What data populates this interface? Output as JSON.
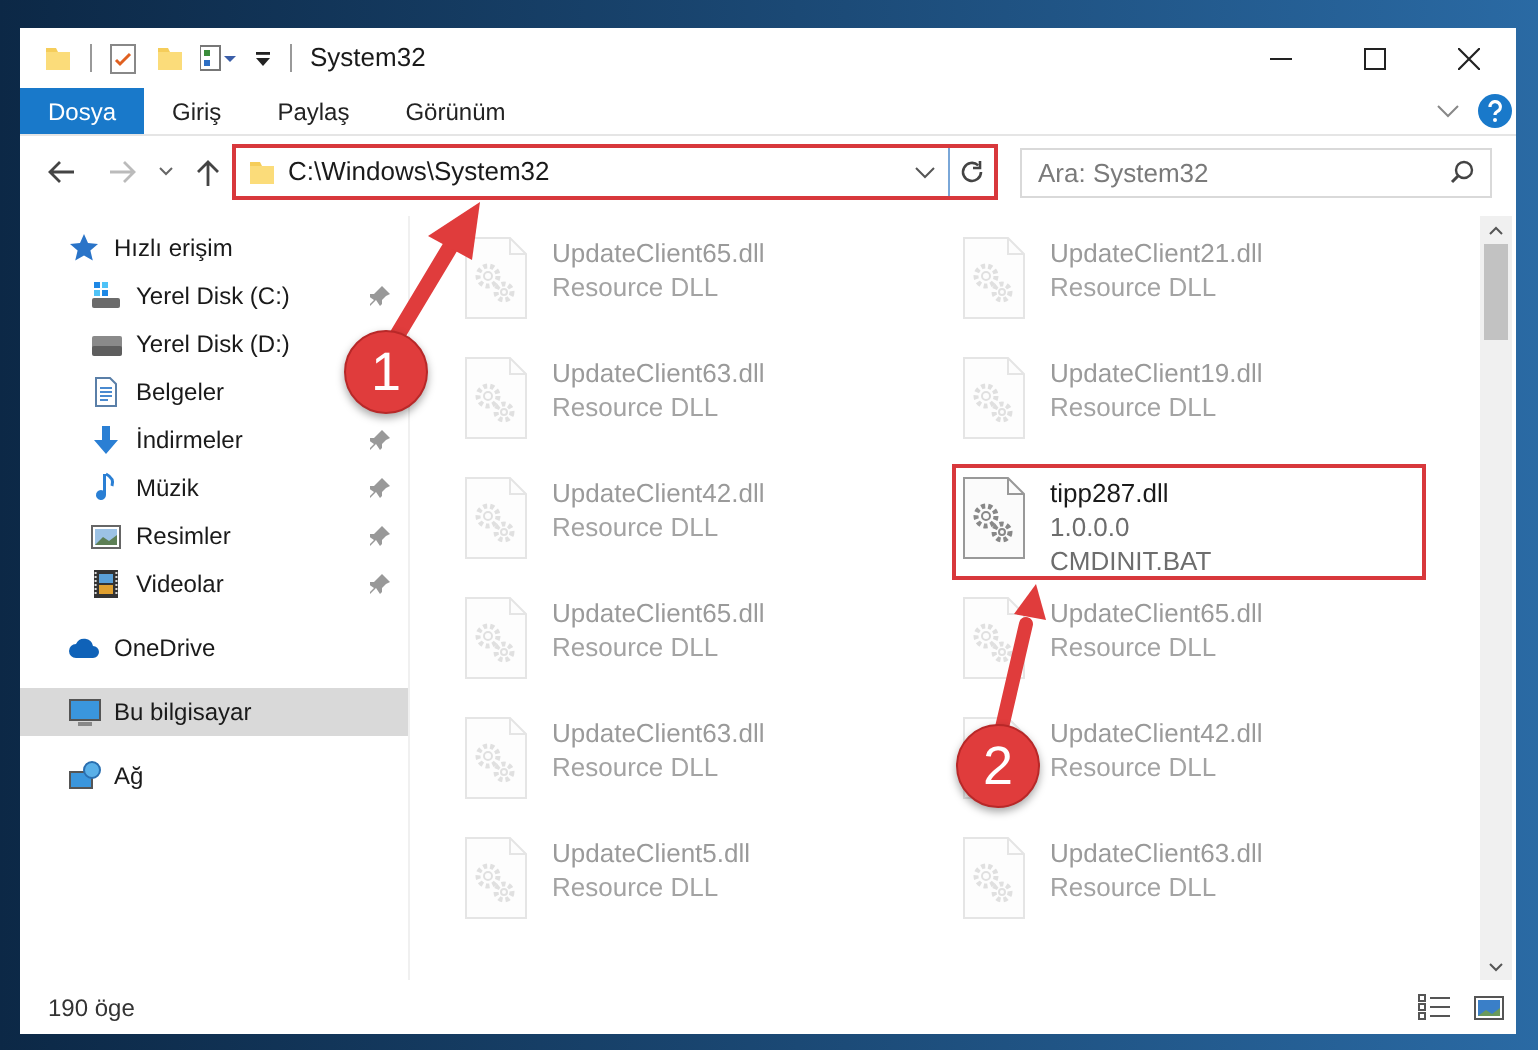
{
  "window": {
    "title": "System32"
  },
  "ribbon_tabs": [
    {
      "label": "Dosya",
      "selected": true
    },
    {
      "label": "Giriş",
      "selected": false
    },
    {
      "label": "Paylaş",
      "selected": false
    },
    {
      "label": "Görünüm",
      "selected": false
    }
  ],
  "address": {
    "path": "C:\\Windows\\System32"
  },
  "search": {
    "placeholder": "Ara: System32"
  },
  "sidebar": {
    "items": [
      {
        "label": "Hızlı erişim",
        "kind": "star",
        "selected": false,
        "children": [
          {
            "label": "Yerel Disk (C:)",
            "kind": "system-drive",
            "pinned": true,
            "selected": false
          },
          {
            "label": "Yerel Disk (D:)",
            "kind": "drive",
            "selected": false
          },
          {
            "label": "Belgeler",
            "kind": "document",
            "selected": false
          },
          {
            "label": "İndirmeler",
            "kind": "download",
            "pinned": true,
            "selected": false
          },
          {
            "label": "Müzik",
            "kind": "music",
            "pinned": true,
            "selected": false
          },
          {
            "label": "Resimler",
            "kind": "image",
            "pinned": true,
            "selected": false
          },
          {
            "label": "Videolar",
            "kind": "video",
            "pinned": true,
            "selected": false
          }
        ]
      },
      {
        "label": "OneDrive",
        "kind": "cloud",
        "selected": false
      },
      {
        "label": "Bu bilgisayar",
        "kind": "computer",
        "selected": true
      },
      {
        "label": "Ağ",
        "kind": "network",
        "selected": false
      }
    ]
  },
  "files": [
    {
      "name": "UpdateClient65.dll",
      "details": [
        "Resource DLL"
      ],
      "highlighted": false
    },
    {
      "name": "UpdateClient21.dll",
      "details": [
        "Resource DLL"
      ],
      "highlighted": false
    },
    {
      "name": "UpdateClient63.dll",
      "details": [
        "Resource DLL"
      ],
      "highlighted": false
    },
    {
      "name": "UpdateClient19.dll",
      "details": [
        "Resource DLL"
      ],
      "highlighted": false
    },
    {
      "name": "UpdateClient42.dll",
      "details": [
        "Resource DLL"
      ],
      "highlighted": false
    },
    {
      "name": "tipp287.dll",
      "details": [
        "1.0.0.0",
        "CMDINIT.BAT"
      ],
      "highlighted": true
    },
    {
      "name": "UpdateClient65.dll",
      "details": [
        "Resource DLL"
      ],
      "highlighted": false
    },
    {
      "name": "UpdateClient65.dll",
      "details": [
        "Resource DLL"
      ],
      "highlighted": false
    },
    {
      "name": "UpdateClient63.dll",
      "details": [
        "Resource DLL"
      ],
      "highlighted": false
    },
    {
      "name": "UpdateClient42.dll",
      "details": [
        "Resource DLL"
      ],
      "highlighted": false
    },
    {
      "name": "UpdateClient5.dll",
      "details": [
        "Resource DLL"
      ],
      "highlighted": false
    },
    {
      "name": "UpdateClient63.dll",
      "details": [
        "Resource DLL"
      ],
      "highlighted": false
    }
  ],
  "status_bar": {
    "count": "190 öge"
  },
  "annotations": [
    {
      "label": "1"
    },
    {
      "label": "2"
    }
  ]
}
